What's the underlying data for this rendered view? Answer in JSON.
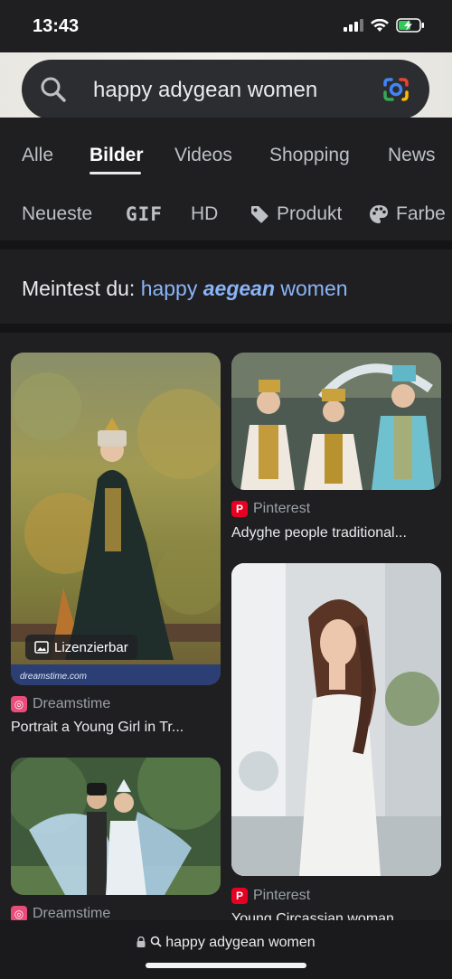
{
  "status": {
    "time": "13:43"
  },
  "search": {
    "query": "happy adygean women",
    "icon": "search-icon",
    "lens_icon": "google-lens-icon"
  },
  "tabs": [
    {
      "label": "Alle",
      "active": false
    },
    {
      "label": "Bilder",
      "active": true
    },
    {
      "label": "Videos",
      "active": false
    },
    {
      "label": "Shopping",
      "active": false
    },
    {
      "label": "News",
      "active": false
    }
  ],
  "chips": [
    {
      "label": "Neueste"
    },
    {
      "label": "GIF"
    },
    {
      "label": "HD"
    },
    {
      "label": "Produkt",
      "icon": "tag-icon"
    },
    {
      "label": "Farbe",
      "icon": "palette-icon"
    }
  ],
  "suggestion": {
    "prefix": "Meintest du: ",
    "word1": "happy ",
    "word2": "aegean",
    "word3": " women"
  },
  "results": [
    {
      "source": "Dreamstime",
      "title": "Portrait a Young Girl in Tr...",
      "badge": "Lizenzierbar",
      "watermark": "dreamstime.com"
    },
    {
      "source": "Pinterest",
      "title": "Adyghe people traditional..."
    },
    {
      "source": "Dreamstime",
      "title": ""
    },
    {
      "source": "Pinterest",
      "title": "Young Circassian woman..."
    }
  ],
  "bottom": {
    "url": "happy adygean women"
  },
  "colors": {
    "background": "#1f1f21",
    "link": "#8ab4f8",
    "text": "#e8eaed"
  }
}
